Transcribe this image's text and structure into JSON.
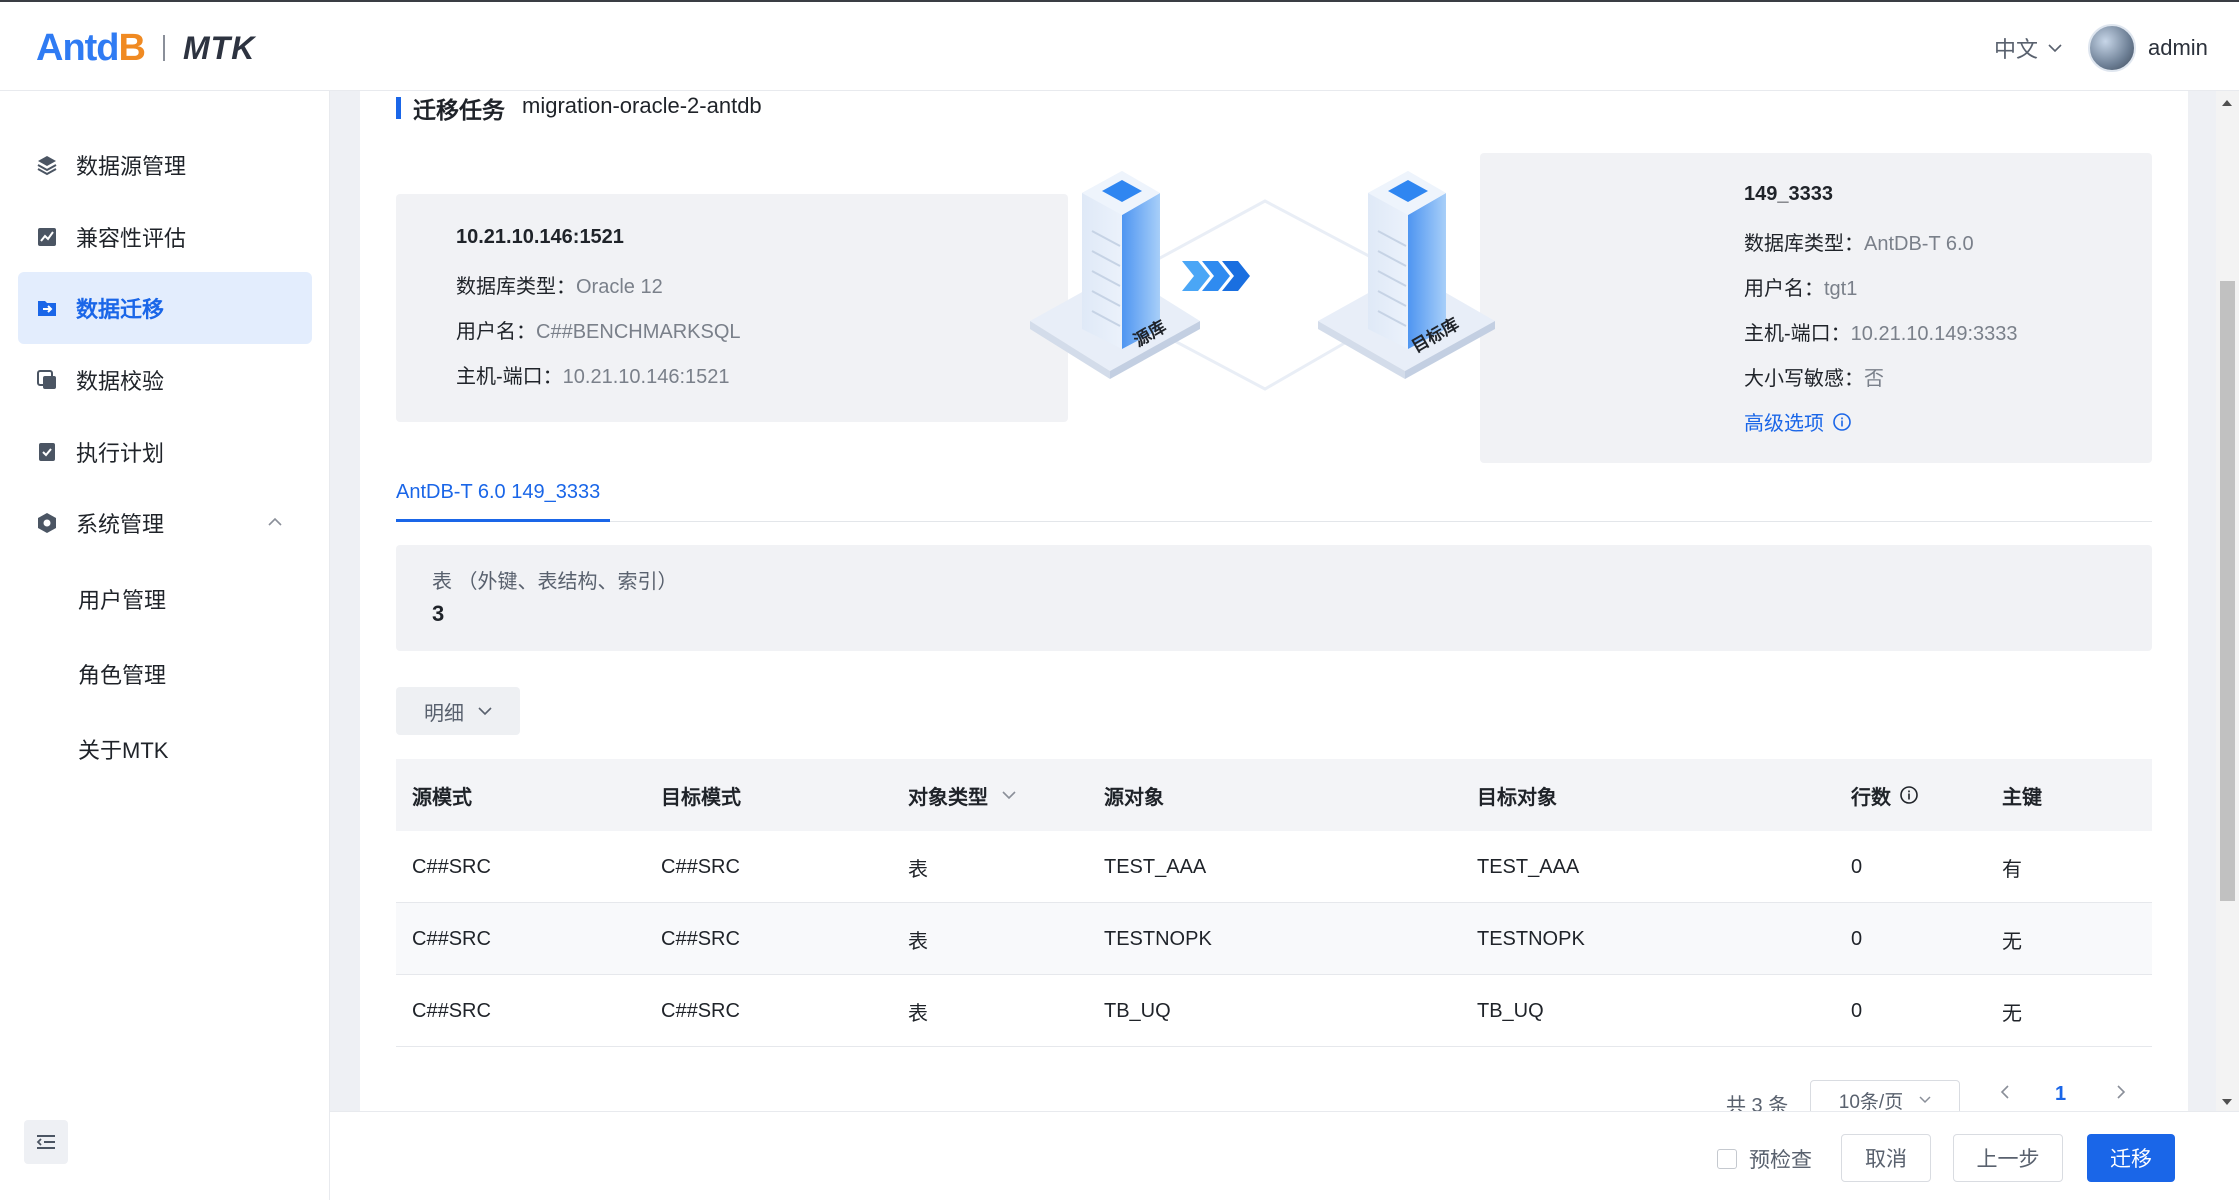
{
  "header": {
    "logo_ant": "Antd",
    "logo_db": "B",
    "logo_mtk": "MTK",
    "language": "中文",
    "username": "admin"
  },
  "sidebar": {
    "items": [
      {
        "label": "数据源管理",
        "icon": "layers-icon"
      },
      {
        "label": "兼容性评估",
        "icon": "chart-icon"
      },
      {
        "label": "数据迁移",
        "icon": "migrate-icon",
        "active": true
      },
      {
        "label": "数据校验",
        "icon": "verify-icon"
      },
      {
        "label": "执行计划",
        "icon": "plan-icon"
      },
      {
        "label": "系统管理",
        "icon": "settings-icon",
        "expanded": true
      }
    ],
    "sub_items": [
      {
        "label": "用户管理"
      },
      {
        "label": "角色管理"
      },
      {
        "label": "关于MTK"
      }
    ]
  },
  "task": {
    "title": "迁移任务",
    "name": "migration-oracle-2-antdb"
  },
  "source": {
    "host": "10.21.10.146:1521",
    "db_type_label": "数据库类型：",
    "db_type": "Oracle 12",
    "user_label": "用户名：",
    "user": "C##BENCHMARKSQL",
    "host_port_label": "主机-端口：",
    "host_port": "10.21.10.146:1521",
    "illus_label": "源库"
  },
  "target": {
    "name": "149_3333",
    "db_type_label": "数据库类型：",
    "db_type": "AntDB-T 6.0",
    "user_label": "用户名：",
    "user": "tgt1",
    "host_port_label": "主机-端口：",
    "host_port": "10.21.10.149:3333",
    "case_label": "大小写敏感：",
    "case_sensitive": "否",
    "advanced_link": "高级选项",
    "illus_label": "目标库"
  },
  "tab": {
    "label": "AntDB-T 6.0 149_3333"
  },
  "stats": {
    "label": "表 （外键、表结构、索引）",
    "value": "3"
  },
  "detail_button": "明细",
  "table": {
    "headers": [
      "源模式",
      "目标模式",
      "对象类型",
      "源对象",
      "目标对象",
      "行数",
      "主键"
    ],
    "rows": [
      [
        "C##SRC",
        "C##SRC",
        "表",
        "TEST_AAA",
        "TEST_AAA",
        "0",
        "有"
      ],
      [
        "C##SRC",
        "C##SRC",
        "表",
        "TESTNOPK",
        "TESTNOPK",
        "0",
        "无"
      ],
      [
        "C##SRC",
        "C##SRC",
        "表",
        "TB_UQ",
        "TB_UQ",
        "0",
        "无"
      ]
    ]
  },
  "pagination": {
    "total": "共 3 条",
    "page_size": "10条/页",
    "current": "1"
  },
  "footer": {
    "precheck": "预检查",
    "cancel": "取消",
    "prev": "上一步",
    "migrate": "迁移"
  },
  "colors": {
    "accent": "#1a66e8",
    "active_bg": "#e3edfd",
    "panel_bg": "#f1f2f5"
  }
}
